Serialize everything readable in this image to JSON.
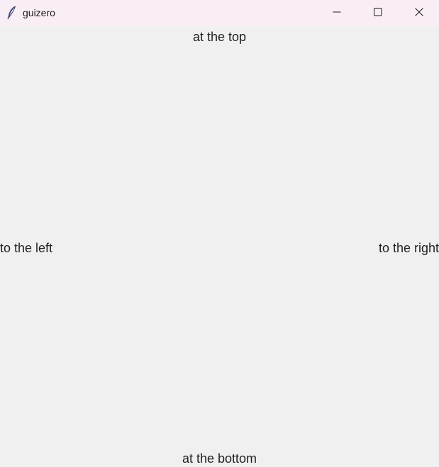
{
  "window": {
    "title": "guizero",
    "app_icon": "feather-icon",
    "controls": {
      "minimize_icon": "minimize-icon",
      "maximize_icon": "maximize-icon",
      "close_icon": "close-icon"
    }
  },
  "labels": {
    "top": "at the top",
    "left": "to the left",
    "right": "to the right",
    "bottom": "at the bottom"
  },
  "colors": {
    "titlebar_bg": "#f9eef6",
    "content_bg": "#f0f0f0",
    "text": "#222222"
  }
}
